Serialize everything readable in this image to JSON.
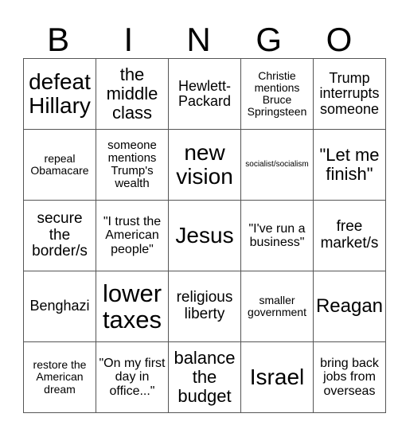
{
  "header": [
    "B",
    "I",
    "N",
    "G",
    "O"
  ],
  "rows": [
    [
      "defeat Hillary",
      "the middle class",
      "Hewlett-Packard",
      "Christie mentions Bruce Springsteen",
      "Trump interrupts someone"
    ],
    [
      "repeal Obamacare",
      "someone mentions Trump's wealth",
      "new vision",
      "socialist/socialism",
      "\"Let me finish\""
    ],
    [
      "secure the border/s",
      "\"I trust the American people\"",
      "Jesus",
      "\"I've run a business\"",
      "free market/s"
    ],
    [
      "Benghazi",
      "lower taxes",
      "religious liberty",
      "smaller government",
      "Reagan"
    ],
    [
      "restore the American dream",
      "\"On my first day in office...\"",
      "balance the budget",
      "Israel",
      "bring back jobs from overseas"
    ]
  ]
}
